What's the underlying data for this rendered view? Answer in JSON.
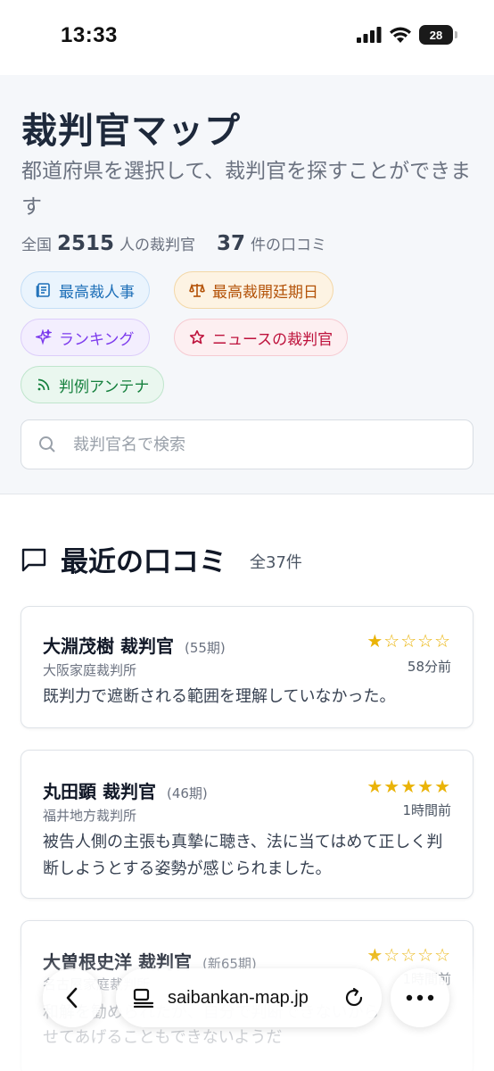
{
  "status_bar": {
    "time": "13:33",
    "battery": "28"
  },
  "header": {
    "title": "裁判官マップ",
    "subtitle": "都道府県を選択して、裁判官を探すことができます",
    "stats": {
      "prefix": "全国",
      "judges_count": "2515",
      "judges_suffix": "人の裁判官",
      "reviews_count": "37",
      "reviews_suffix": "件の口コミ"
    },
    "chips": [
      {
        "label": "最高裁人事",
        "icon": "newspaper-icon"
      },
      {
        "label": "最高裁開廷期日",
        "icon": "scale-icon"
      },
      {
        "label": "ランキング",
        "icon": "sparkles-icon"
      },
      {
        "label": "ニュースの裁判官",
        "icon": "star-icon"
      },
      {
        "label": "判例アンテナ",
        "icon": "rss-icon"
      }
    ],
    "search": {
      "placeholder": "裁判官名で検索"
    }
  },
  "reviews": {
    "title": "最近の口コミ",
    "count_label": "全37件",
    "items": [
      {
        "name": "大淵茂樹 裁判官",
        "term": "(55期)",
        "court": "大阪家庭裁判所",
        "rating": 1,
        "stars": "★☆☆☆☆",
        "time": "58分前",
        "text": "既判力で遮断される範囲を理解していなかった。"
      },
      {
        "name": "丸田顕 裁判官",
        "term": "(46期)",
        "court": "福井地方裁判所",
        "rating": 5,
        "stars": "★★★★★",
        "time": "1時間前",
        "text": "被告人側の主張も真摯に聴き、法に当てはめて正しく判断しようとする姿勢が感じられました。"
      },
      {
        "name": "大曽根史洋 裁判官",
        "term": "(新65期)",
        "court": "名古屋家庭裁判所",
        "rating": 1,
        "stars": "★☆☆☆☆",
        "time": "1時間前",
        "text": "和解を勧められたが、自分で判断できないから",
        "text2": "せてあげることもできないようだ"
      }
    ]
  },
  "browser": {
    "url": "saibankan-map.jp"
  },
  "colors": {
    "star": "#eab308",
    "chip_blue": "#1d6fb8",
    "chip_orange": "#b45309",
    "chip_purple": "#7c3aed",
    "chip_pink": "#be123c",
    "chip_green": "#15803d"
  }
}
